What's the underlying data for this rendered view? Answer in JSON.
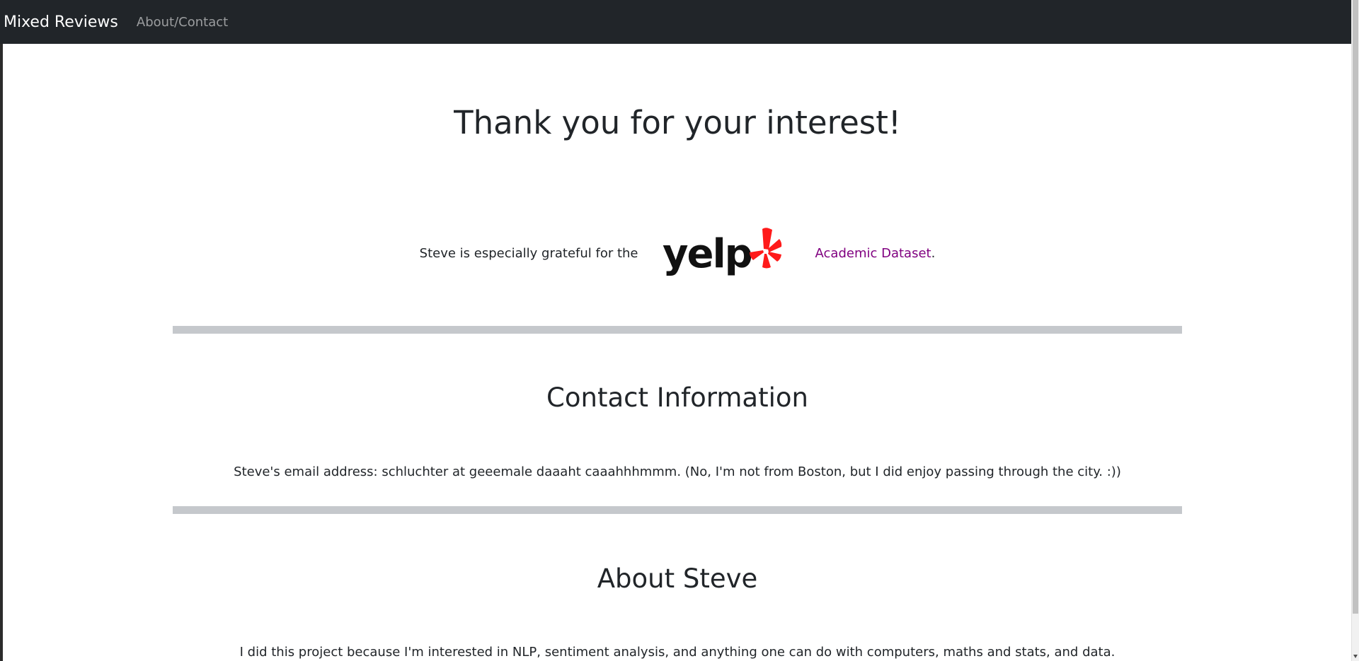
{
  "navbar": {
    "brand": "Mixed Reviews",
    "links": [
      {
        "label": "About/Contact"
      }
    ]
  },
  "hero": {
    "title": "Thank you for your interest!"
  },
  "thanks": {
    "prefix": "Steve is especially grateful for the",
    "logo_text": "yelp",
    "link_label": "Academic Dataset",
    "suffix": "."
  },
  "contact": {
    "heading": "Contact Information",
    "text": "Steve's email address: schluchter at geeemale daaaht caaahhhmmm. (No, I'm not from Boston, but I did enjoy passing through the city. :))"
  },
  "about": {
    "heading": "About Steve",
    "text": "I did this project because I'm interested in NLP, sentiment analysis, and anything one can do with computers, maths and stats, and data."
  },
  "colors": {
    "navbar_bg": "#212529",
    "link_visited": "#800080",
    "yelp_red": "#ff1a1a",
    "divider": "#c5c8cc"
  }
}
